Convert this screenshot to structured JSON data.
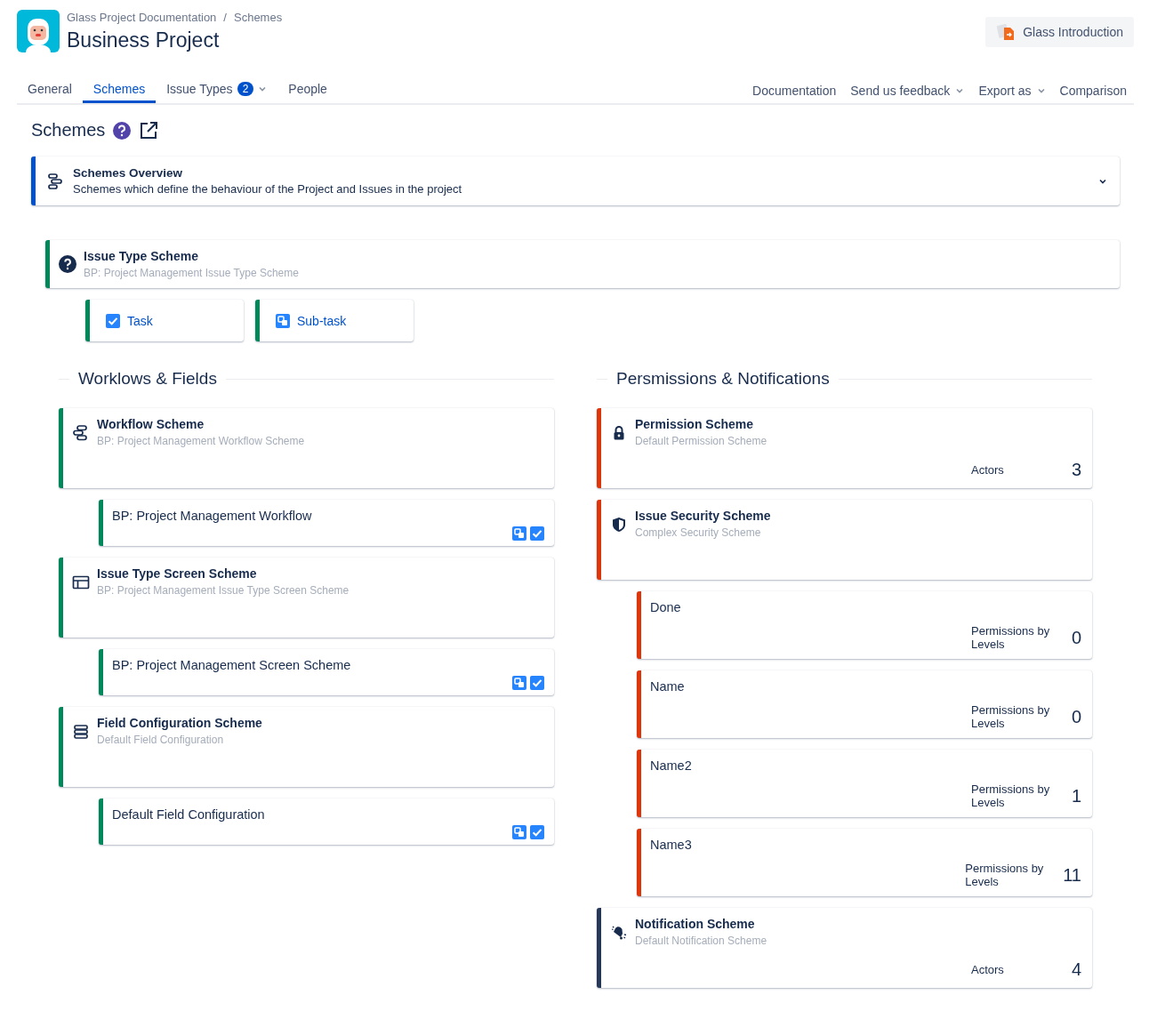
{
  "breadcrumb": {
    "items": [
      "Glass Project Documentation",
      "Schemes"
    ],
    "separator": "/"
  },
  "title": "Business Project",
  "intro_button": "Glass Introduction",
  "tabs": [
    {
      "label": "General",
      "selected": false
    },
    {
      "label": "Schemes",
      "selected": true
    },
    {
      "label": "Issue Types",
      "badge": "2",
      "dropdown": true,
      "selected": false
    },
    {
      "label": "People",
      "selected": false
    }
  ],
  "actions": [
    {
      "label": "Documentation",
      "dropdown": false
    },
    {
      "label": "Send us feedback",
      "dropdown": true
    },
    {
      "label": "Export as",
      "dropdown": true
    },
    {
      "label": "Comparison",
      "dropdown": false
    }
  ],
  "page_heading": "Schemes",
  "overview": {
    "title": "Schemes Overview",
    "description": "Schemes which define the behaviour of the Project and Issues in the project",
    "expanded": false
  },
  "issue_type_scheme": {
    "title": "Issue Type Scheme",
    "subtitle": "BP: Project Management Issue Type Scheme",
    "color": "#00875a",
    "types": [
      {
        "label": "Task"
      },
      {
        "label": "Sub-task"
      }
    ]
  },
  "workflows_fields": {
    "heading": "Worklows & Fields",
    "items": [
      {
        "kind": "scheme",
        "title": "Workflow Scheme",
        "subtitle": "BP: Project Management Workflow Scheme",
        "color": "#00875a"
      },
      {
        "kind": "item",
        "label": "BP: Project Management Workflow",
        "color": "#00875a"
      },
      {
        "kind": "scheme",
        "title": "Issue Type Screen Scheme",
        "subtitle": "BP: Project Management Issue Type Screen Scheme",
        "color": "#00875a"
      },
      {
        "kind": "item",
        "label": "BP: Project Management Screen Scheme",
        "color": "#00875a"
      },
      {
        "kind": "scheme",
        "title": "Field Configuration Scheme",
        "subtitle": "Default Field Configuration",
        "color": "#00875a"
      },
      {
        "kind": "item",
        "label": "Default Field Configuration",
        "color": "#00875a"
      }
    ]
  },
  "permissions_notifications": {
    "heading": "Persmissions & Notifications",
    "items": [
      {
        "kind": "scheme",
        "title": "Permission Scheme",
        "subtitle": "Default Permission Scheme",
        "color": "#de350b",
        "stat_label": "Actors",
        "stat_value": "3"
      },
      {
        "kind": "scheme",
        "title": "Issue Security Scheme",
        "subtitle": "Complex Security Scheme",
        "color": "#de350b"
      },
      {
        "kind": "item",
        "label": "Done",
        "color": "#de350b",
        "stat_label": "Permissions by Levels",
        "stat_value": "0"
      },
      {
        "kind": "item",
        "label": "Name",
        "color": "#de350b",
        "stat_label": "Permissions by Levels",
        "stat_value": "0"
      },
      {
        "kind": "item",
        "label": "Name2",
        "color": "#de350b",
        "stat_label": "Permissions by Levels",
        "stat_value": "1"
      },
      {
        "kind": "item",
        "label": "Name3",
        "color": "#de350b",
        "stat_label": "Permissions by Levels",
        "stat_value": "11"
      },
      {
        "kind": "scheme",
        "title": "Notification Scheme",
        "subtitle": "Default Notification Scheme",
        "color": "#253858",
        "stat_label": "Actors",
        "stat_value": "4"
      }
    ]
  }
}
